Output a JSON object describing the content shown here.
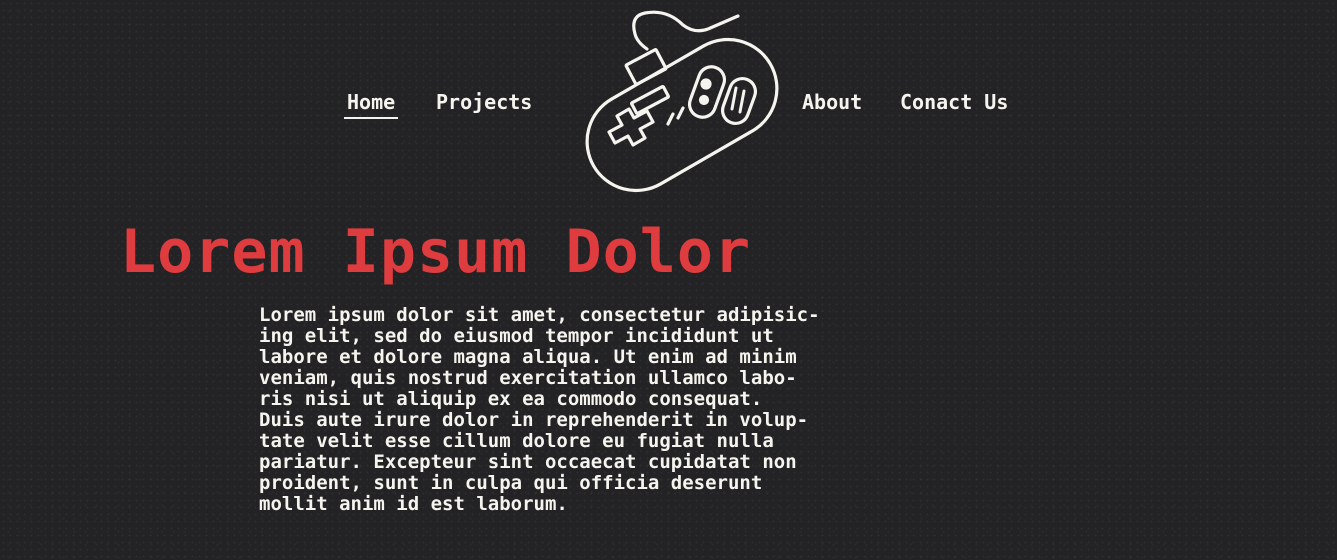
{
  "nav": {
    "items": [
      {
        "label": "Home",
        "active": true
      },
      {
        "label": "Projects",
        "active": false
      },
      {
        "label": "About",
        "active": false
      },
      {
        "label": "Conact Us",
        "active": false
      }
    ]
  },
  "logo": {
    "icon": "gamepad-icon"
  },
  "hero": {
    "title": "Lorem Ipsum Dolor",
    "body": "Lorem ipsum dolor sit amet, consectetur adipisic-\ning elit, sed do eiusmod tempor incididunt ut\nlabore et dolore magna aliqua. Ut enim ad minim\nveniam, quis nostrud exercitation ullamco labo-\nris nisi ut aliquip ex ea commodo consequat.\nDuis aute irure dolor in reprehenderit in volup-\ntate velit esse cillum dolore eu fugiat nulla\npariatur. Excepteur sint occaecat cupidatat non\nproident, sunt in culpa qui officia deserunt\nmollit anim id est laborum."
  },
  "colors": {
    "background": "#232224",
    "text": "#f6f4ee",
    "accent": "#de3c3e"
  }
}
